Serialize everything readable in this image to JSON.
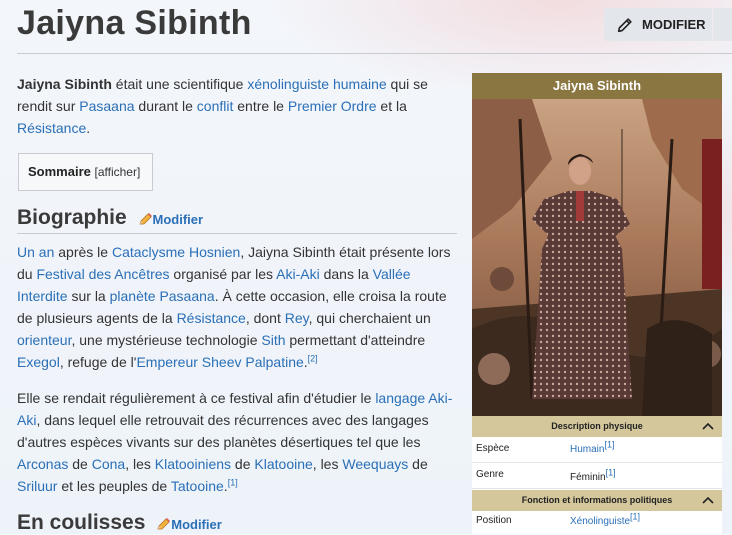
{
  "page": {
    "title": "Jaiyna Sibinth",
    "edit_button": "MODIFIER"
  },
  "intro": {
    "name": "Jaiyna Sibinth",
    "t1": " était une scientifique ",
    "l1": "xénolinguiste",
    "t2": " ",
    "l2": "humaine",
    "t3": " qui se rendit sur ",
    "l3": "Pasaana",
    "t4": " durant le ",
    "l4": "conflit",
    "t5": " entre le ",
    "l5": "Premier Ordre",
    "t6": " et la ",
    "l6": "Résistance",
    "t7": "."
  },
  "toc": {
    "title": "Sommaire",
    "open": "[",
    "toggle": "afficher",
    "close": "]"
  },
  "sections": {
    "biography": {
      "title": "Biographie",
      "edit": "Modifier"
    },
    "behind": {
      "title": "En coulisses",
      "edit": "Modifier"
    }
  },
  "bio1": {
    "l1": "Un an",
    "t1": " après le ",
    "l2": "Cataclysme Hosnien",
    "t2": ", Jaiyna Sibinth était présente lors du ",
    "l3": "Festival des Ancêtres",
    "t3": " organisé par les ",
    "l4": "Aki-Aki",
    "t4": " dans la ",
    "l5": "Vallée Interdite",
    "t5": " sur la ",
    "l6": "planète",
    "t6": " ",
    "l7": "Pasaana",
    "t7": ". À cette occasion, elle croisa la route de plusieurs agents de la ",
    "l8": "Résistance",
    "t8": ", dont ",
    "l9": "Rey",
    "t9": ", qui cherchaient un ",
    "l10": "orienteur",
    "t10": ", une mystérieuse technologie ",
    "l11": "Sith",
    "t11": " permettant d'atteindre ",
    "l12": "Exegol",
    "t12": ", refuge de l'",
    "l13": "Empereur Sheev Palpatine",
    "t13": ".",
    "ref": "[2]"
  },
  "bio2": {
    "t1": "Elle se rendait régulièrement à ce festival afin d'étudier le ",
    "l1": "langage Aki-Aki",
    "t2": ", dans lequel elle retrouvait des récurrences avec des langages d'autres espèces vivants sur des planètes désertiques tel que les ",
    "l2": "Arconas",
    "t3": " de ",
    "l3": "Cona",
    "t4": ", les ",
    "l4": "Klatooiniens",
    "t5": " de ",
    "l5": "Klatooine",
    "t6": ", les ",
    "l6": "Weequays",
    "t7": " de ",
    "l7": "Sriluur",
    "t8": " et les peuples de ",
    "l8": "Tatooine",
    "t9": ".",
    "ref": "[1]"
  },
  "infobox": {
    "title": "Jaiyna Sibinth",
    "section1": "Description physique",
    "rows1": [
      {
        "key": "Espèce",
        "value": "Humain",
        "ref": "[1]",
        "link": true
      },
      {
        "key": "Genre",
        "value": "Féminin",
        "ref": "[1]",
        "link": false
      }
    ],
    "section2": "Fonction et informations politiques",
    "rows2": [
      {
        "key": "Position",
        "value": "Xénolinguiste",
        "ref": "[1]",
        "link": true
      }
    ]
  },
  "colors": {
    "link": "#2a6fb7",
    "infobox_header": "#8a7640",
    "infobox_section": "#d4c79c"
  }
}
